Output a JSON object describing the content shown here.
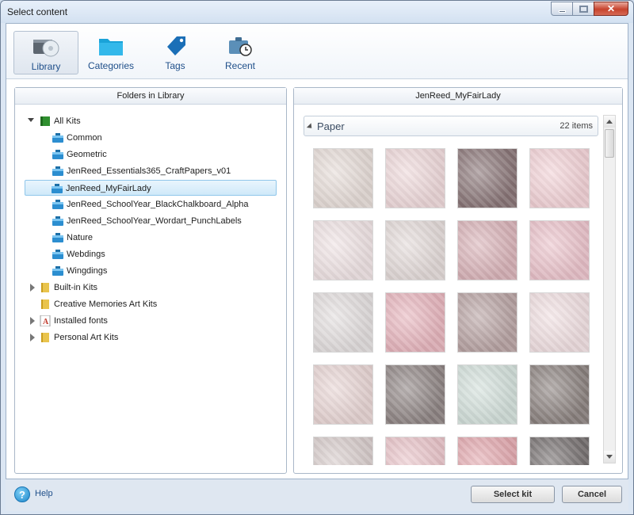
{
  "window": {
    "title": "Select content"
  },
  "toolbar": {
    "items": [
      {
        "label": "Library",
        "icon": "library-disc-icon",
        "selected": true
      },
      {
        "label": "Categories",
        "icon": "folder-icon",
        "selected": false
      },
      {
        "label": "Tags",
        "icon": "tag-icon",
        "selected": false
      },
      {
        "label": "Recent",
        "icon": "recent-clock-icon",
        "selected": false
      }
    ]
  },
  "left_panel": {
    "title": "Folders in Library",
    "tree": [
      {
        "label": "All Kits",
        "expander": "open",
        "icon": "green-book-icon"
      },
      {
        "label": "Common",
        "icon": "kit-box-icon"
      },
      {
        "label": "Geometric",
        "icon": "kit-box-icon"
      },
      {
        "label": "JenReed_Essentials365_CraftPapers_v01",
        "icon": "kit-box-icon"
      },
      {
        "label": "JenReed_MyFairLady",
        "icon": "kit-box-icon",
        "selected": true
      },
      {
        "label": "JenReed_SchoolYear_BlackChalkboard_Alpha",
        "icon": "kit-box-icon"
      },
      {
        "label": "JenReed_SchoolYear_Wordart_PunchLabels",
        "icon": "kit-box-icon"
      },
      {
        "label": "Nature",
        "icon": "kit-box-icon"
      },
      {
        "label": "Webdings",
        "icon": "kit-box-icon"
      },
      {
        "label": "Wingdings",
        "icon": "kit-box-icon"
      },
      {
        "label": "Built-in Kits",
        "expander": "closed",
        "icon": "yellow-folder-icon"
      },
      {
        "label": "Creative Memories Art Kits",
        "icon": "yellow-folder-icon"
      },
      {
        "label": "Installed fonts",
        "expander": "closed",
        "icon": "font-a-icon"
      },
      {
        "label": "Personal Art Kits",
        "expander": "closed",
        "icon": "yellow-folder-icon"
      }
    ]
  },
  "right_panel": {
    "title": "JenReed_MyFairLady",
    "group": {
      "name": "Paper",
      "count": "22 items"
    },
    "thumbnail_colors": [
      "#e6dcd7",
      "#eed8da",
      "#8a7678",
      "#f2d2d6",
      "#efe3e4",
      "#e4dbd9",
      "#d9b3b8",
      "#ebc3cb",
      "#e3dede",
      "#e7b5bd",
      "#b8a3a3",
      "#f0dfe1",
      "#e8d5d4",
      "#8f8584",
      "#d3e0db",
      "#8b827f",
      "#d7cccb",
      "#e9c4c9",
      "#e3a9af",
      "#767070"
    ]
  },
  "footer": {
    "help_label": "Help",
    "select_kit_label": "Select kit",
    "cancel_label": "Cancel"
  },
  "colors": {
    "accent_blue": "#1f4f8a",
    "selection": "#cfe9f9"
  }
}
